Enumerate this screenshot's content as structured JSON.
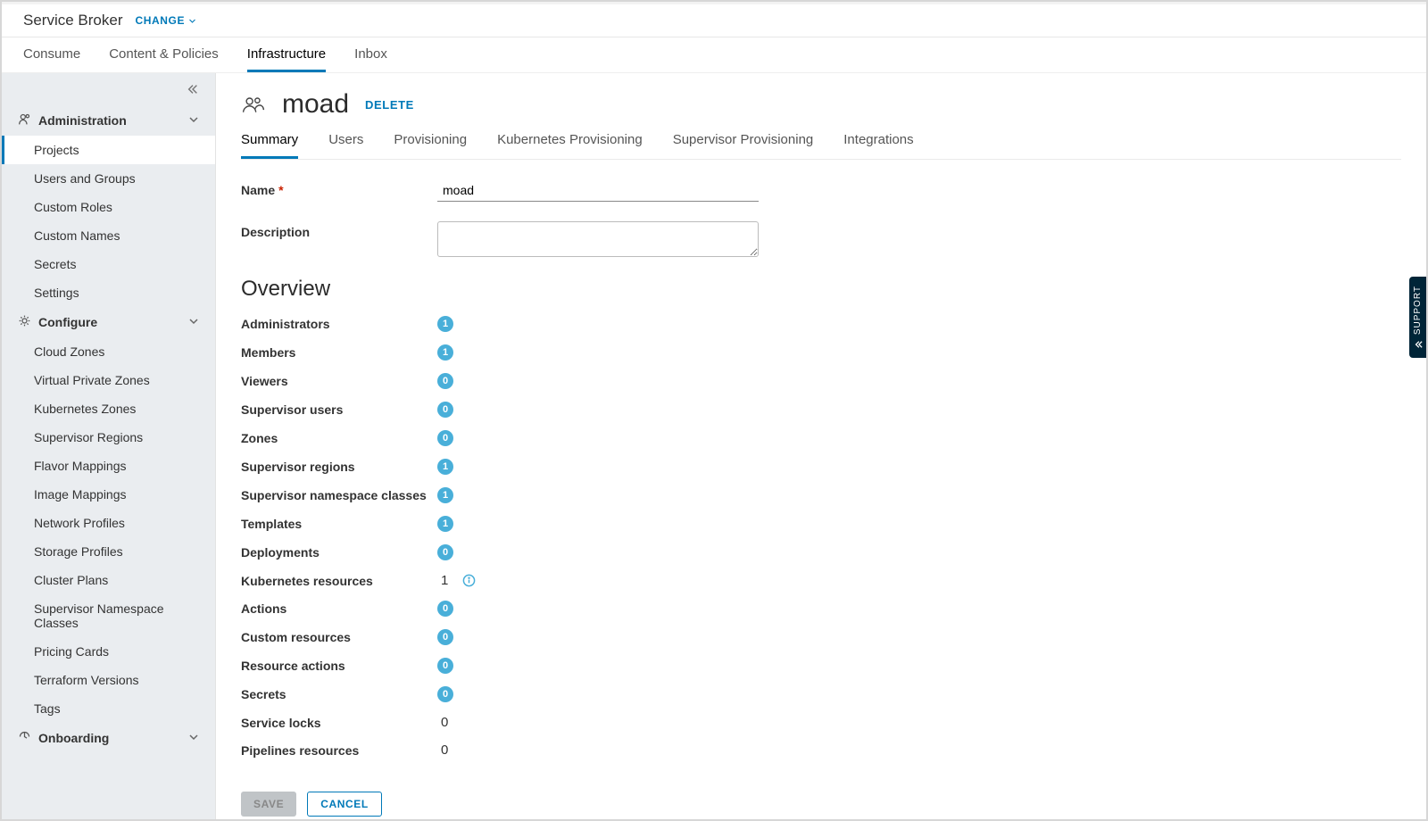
{
  "topbar": {
    "app_title": "Service Broker",
    "change_label": "CHANGE"
  },
  "main_tabs": [
    {
      "label": "Consume",
      "active": false
    },
    {
      "label": "Content & Policies",
      "active": false
    },
    {
      "label": "Infrastructure",
      "active": true
    },
    {
      "label": "Inbox",
      "active": false
    }
  ],
  "sidebar": {
    "sections": [
      {
        "title": "Administration",
        "icon": "admin-icon",
        "items": [
          {
            "label": "Projects",
            "active": true
          },
          {
            "label": "Users and Groups",
            "active": false
          },
          {
            "label": "Custom Roles",
            "active": false
          },
          {
            "label": "Custom Names",
            "active": false
          },
          {
            "label": "Secrets",
            "active": false
          },
          {
            "label": "Settings",
            "active": false
          }
        ]
      },
      {
        "title": "Configure",
        "icon": "configure-icon",
        "items": [
          {
            "label": "Cloud Zones",
            "active": false
          },
          {
            "label": "Virtual Private Zones",
            "active": false
          },
          {
            "label": "Kubernetes Zones",
            "active": false
          },
          {
            "label": "Supervisor Regions",
            "active": false
          },
          {
            "label": "Flavor Mappings",
            "active": false
          },
          {
            "label": "Image Mappings",
            "active": false
          },
          {
            "label": "Network Profiles",
            "active": false
          },
          {
            "label": "Storage Profiles",
            "active": false
          },
          {
            "label": "Cluster Plans",
            "active": false
          },
          {
            "label": "Supervisor Namespace Classes",
            "active": false
          },
          {
            "label": "Pricing Cards",
            "active": false
          },
          {
            "label": "Terraform Versions",
            "active": false
          },
          {
            "label": "Tags",
            "active": false
          }
        ]
      },
      {
        "title": "Onboarding",
        "icon": "onboarding-icon",
        "items": []
      }
    ]
  },
  "page": {
    "title": "moad",
    "delete_label": "DELETE",
    "sub_tabs": [
      {
        "label": "Summary",
        "active": true
      },
      {
        "label": "Users",
        "active": false
      },
      {
        "label": "Provisioning",
        "active": false
      },
      {
        "label": "Kubernetes Provisioning",
        "active": false
      },
      {
        "label": "Supervisor Provisioning",
        "active": false
      },
      {
        "label": "Integrations",
        "active": false
      }
    ],
    "form": {
      "name_label": "Name",
      "name_value": "moad",
      "description_label": "Description",
      "description_value": ""
    },
    "overview_title": "Overview",
    "overview": [
      {
        "label": "Administrators",
        "value": "1",
        "badge": true,
        "info": false
      },
      {
        "label": "Members",
        "value": "1",
        "badge": true,
        "info": false
      },
      {
        "label": "Viewers",
        "value": "0",
        "badge": true,
        "info": false
      },
      {
        "label": "Supervisor users",
        "value": "0",
        "badge": true,
        "info": false
      },
      {
        "label": "Zones",
        "value": "0",
        "badge": true,
        "info": false
      },
      {
        "label": "Supervisor regions",
        "value": "1",
        "badge": true,
        "info": false
      },
      {
        "label": "Supervisor namespace classes",
        "value": "1",
        "badge": true,
        "info": false
      },
      {
        "label": "Templates",
        "value": "1",
        "badge": true,
        "info": false
      },
      {
        "label": "Deployments",
        "value": "0",
        "badge": true,
        "info": false
      },
      {
        "label": "Kubernetes resources",
        "value": "1",
        "badge": false,
        "info": true
      },
      {
        "label": "Actions",
        "value": "0",
        "badge": true,
        "info": false
      },
      {
        "label": "Custom resources",
        "value": "0",
        "badge": true,
        "info": false
      },
      {
        "label": "Resource actions",
        "value": "0",
        "badge": true,
        "info": false
      },
      {
        "label": "Secrets",
        "value": "0",
        "badge": true,
        "info": false
      },
      {
        "label": "Service locks",
        "value": "0",
        "badge": false,
        "info": false
      },
      {
        "label": "Pipelines resources",
        "value": "0",
        "badge": false,
        "info": false
      }
    ],
    "footer": {
      "save": "SAVE",
      "cancel": "CANCEL"
    }
  },
  "support_tab": "SUPPORT"
}
